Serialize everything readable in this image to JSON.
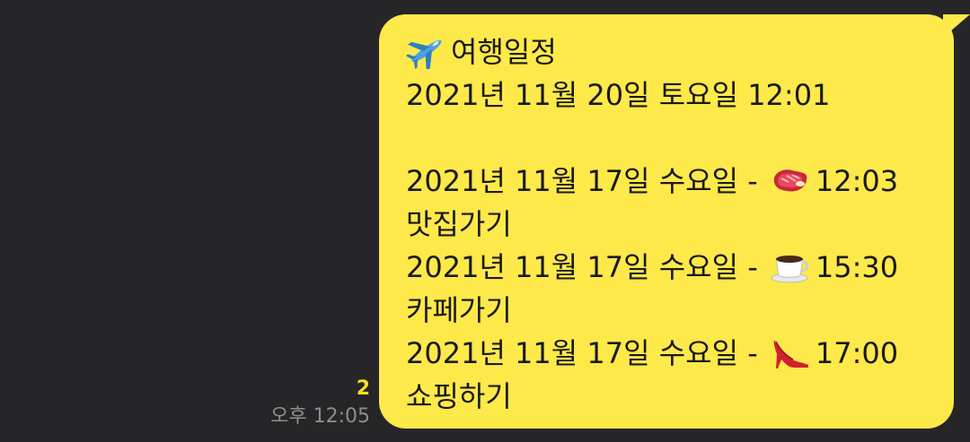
{
  "message": {
    "title_icon": "airplane-icon",
    "title": "여행일정",
    "date_line": "2021년 11월 20일 토요일 12:01",
    "items": [
      {
        "date": "2021년 11월 17일 수요일 -",
        "icon": "steak-icon",
        "time": "12:03",
        "label": "맛집가기"
      },
      {
        "date": "2021년 11월 17일 수요일 -",
        "icon": "coffee-cup-icon",
        "time": "15:30",
        "label": "카페가기"
      },
      {
        "date": "2021년 11월 17일 수요일 -",
        "icon": "high-heel-icon",
        "time": "17:00",
        "label": "쇼핑하기"
      }
    ],
    "unread_count": "2",
    "timestamp": "오후 12:05"
  },
  "colors": {
    "background": "#262628",
    "bubble": "#fee94a",
    "unread": "#f5df2c",
    "timestamp": "#8e8e8e"
  }
}
